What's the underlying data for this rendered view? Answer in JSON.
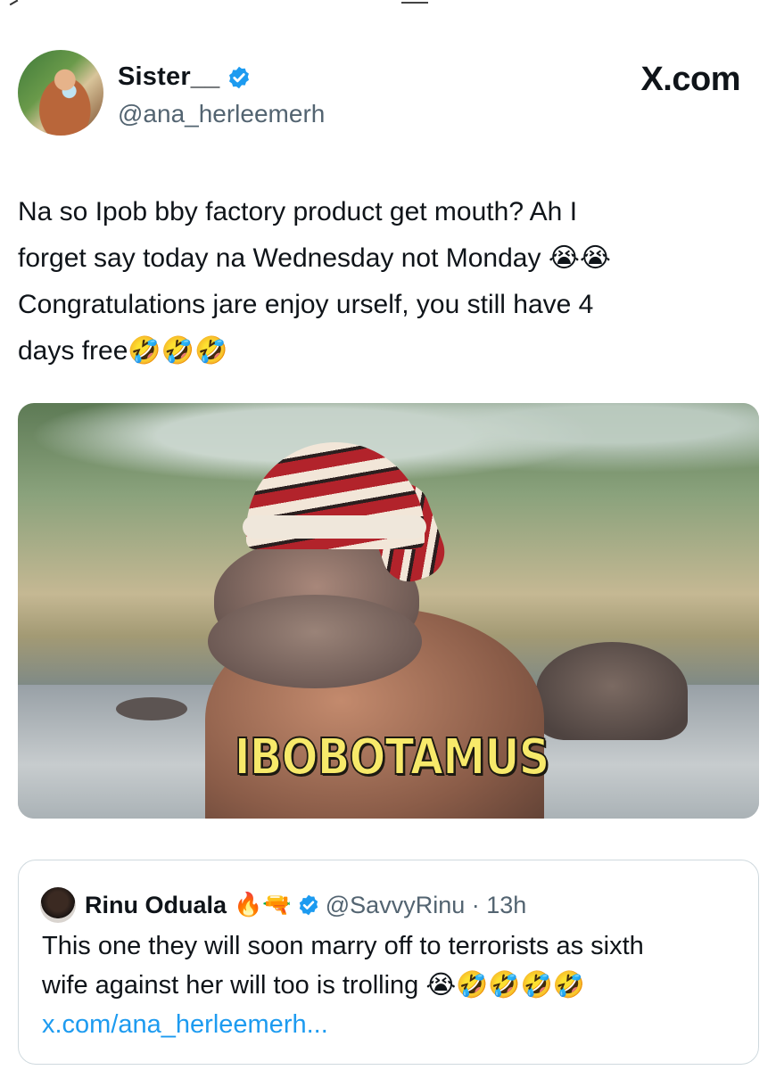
{
  "brand": "X.com",
  "author": {
    "display_name": "Sister__",
    "handle": "@ana_herleemerh",
    "verified": true
  },
  "tweet": {
    "lines": [
      "Na so Ipob bby factory product get mouth? Ah I",
      "forget say today na Wednesday not Monday 😭😭",
      "Congratulations jare enjoy urself, you still have 4",
      "days free🤣🤣🤣"
    ]
  },
  "media": {
    "caption": "IBOBOTAMUS"
  },
  "quoted_tweet": {
    "display_name": "Rinu Oduala",
    "name_emojis": "🔥🔫",
    "handle_time": "@SavvyRinu · 13h",
    "lines": [
      "This one they will soon marry off to terrorists as  sixth",
      "wife against her will too is trolling 😭🤣🤣🤣🤣"
    ],
    "link": "x.com/ana_herleemerh..."
  },
  "colors": {
    "verified": "#1d9bf0",
    "link": "#1d9bf0",
    "muted": "#536471"
  },
  "icons": [
    "verified-badge-icon"
  ]
}
